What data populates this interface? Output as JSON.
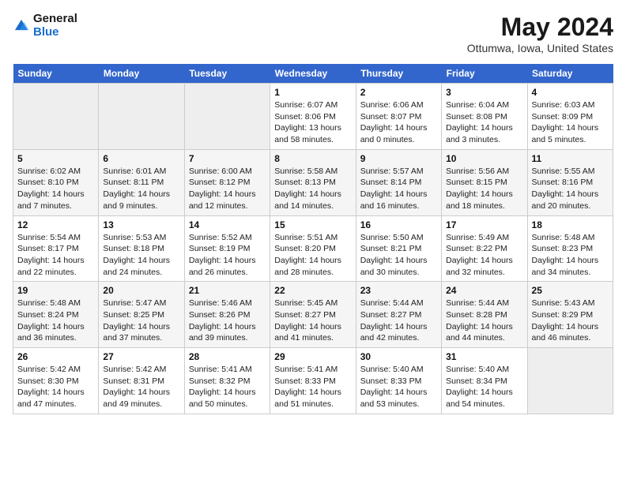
{
  "logo": {
    "general": "General",
    "blue": "Blue"
  },
  "title": "May 2024",
  "subtitle": "Ottumwa, Iowa, United States",
  "days_of_week": [
    "Sunday",
    "Monday",
    "Tuesday",
    "Wednesday",
    "Thursday",
    "Friday",
    "Saturday"
  ],
  "weeks": [
    [
      {
        "num": "",
        "info": ""
      },
      {
        "num": "",
        "info": ""
      },
      {
        "num": "",
        "info": ""
      },
      {
        "num": "1",
        "info": "Sunrise: 6:07 AM\nSunset: 8:06 PM\nDaylight: 13 hours\nand 58 minutes."
      },
      {
        "num": "2",
        "info": "Sunrise: 6:06 AM\nSunset: 8:07 PM\nDaylight: 14 hours\nand 0 minutes."
      },
      {
        "num": "3",
        "info": "Sunrise: 6:04 AM\nSunset: 8:08 PM\nDaylight: 14 hours\nand 3 minutes."
      },
      {
        "num": "4",
        "info": "Sunrise: 6:03 AM\nSunset: 8:09 PM\nDaylight: 14 hours\nand 5 minutes."
      }
    ],
    [
      {
        "num": "5",
        "info": "Sunrise: 6:02 AM\nSunset: 8:10 PM\nDaylight: 14 hours\nand 7 minutes."
      },
      {
        "num": "6",
        "info": "Sunrise: 6:01 AM\nSunset: 8:11 PM\nDaylight: 14 hours\nand 9 minutes."
      },
      {
        "num": "7",
        "info": "Sunrise: 6:00 AM\nSunset: 8:12 PM\nDaylight: 14 hours\nand 12 minutes."
      },
      {
        "num": "8",
        "info": "Sunrise: 5:58 AM\nSunset: 8:13 PM\nDaylight: 14 hours\nand 14 minutes."
      },
      {
        "num": "9",
        "info": "Sunrise: 5:57 AM\nSunset: 8:14 PM\nDaylight: 14 hours\nand 16 minutes."
      },
      {
        "num": "10",
        "info": "Sunrise: 5:56 AM\nSunset: 8:15 PM\nDaylight: 14 hours\nand 18 minutes."
      },
      {
        "num": "11",
        "info": "Sunrise: 5:55 AM\nSunset: 8:16 PM\nDaylight: 14 hours\nand 20 minutes."
      }
    ],
    [
      {
        "num": "12",
        "info": "Sunrise: 5:54 AM\nSunset: 8:17 PM\nDaylight: 14 hours\nand 22 minutes."
      },
      {
        "num": "13",
        "info": "Sunrise: 5:53 AM\nSunset: 8:18 PM\nDaylight: 14 hours\nand 24 minutes."
      },
      {
        "num": "14",
        "info": "Sunrise: 5:52 AM\nSunset: 8:19 PM\nDaylight: 14 hours\nand 26 minutes."
      },
      {
        "num": "15",
        "info": "Sunrise: 5:51 AM\nSunset: 8:20 PM\nDaylight: 14 hours\nand 28 minutes."
      },
      {
        "num": "16",
        "info": "Sunrise: 5:50 AM\nSunset: 8:21 PM\nDaylight: 14 hours\nand 30 minutes."
      },
      {
        "num": "17",
        "info": "Sunrise: 5:49 AM\nSunset: 8:22 PM\nDaylight: 14 hours\nand 32 minutes."
      },
      {
        "num": "18",
        "info": "Sunrise: 5:48 AM\nSunset: 8:23 PM\nDaylight: 14 hours\nand 34 minutes."
      }
    ],
    [
      {
        "num": "19",
        "info": "Sunrise: 5:48 AM\nSunset: 8:24 PM\nDaylight: 14 hours\nand 36 minutes."
      },
      {
        "num": "20",
        "info": "Sunrise: 5:47 AM\nSunset: 8:25 PM\nDaylight: 14 hours\nand 37 minutes."
      },
      {
        "num": "21",
        "info": "Sunrise: 5:46 AM\nSunset: 8:26 PM\nDaylight: 14 hours\nand 39 minutes."
      },
      {
        "num": "22",
        "info": "Sunrise: 5:45 AM\nSunset: 8:27 PM\nDaylight: 14 hours\nand 41 minutes."
      },
      {
        "num": "23",
        "info": "Sunrise: 5:44 AM\nSunset: 8:27 PM\nDaylight: 14 hours\nand 42 minutes."
      },
      {
        "num": "24",
        "info": "Sunrise: 5:44 AM\nSunset: 8:28 PM\nDaylight: 14 hours\nand 44 minutes."
      },
      {
        "num": "25",
        "info": "Sunrise: 5:43 AM\nSunset: 8:29 PM\nDaylight: 14 hours\nand 46 minutes."
      }
    ],
    [
      {
        "num": "26",
        "info": "Sunrise: 5:42 AM\nSunset: 8:30 PM\nDaylight: 14 hours\nand 47 minutes."
      },
      {
        "num": "27",
        "info": "Sunrise: 5:42 AM\nSunset: 8:31 PM\nDaylight: 14 hours\nand 49 minutes."
      },
      {
        "num": "28",
        "info": "Sunrise: 5:41 AM\nSunset: 8:32 PM\nDaylight: 14 hours\nand 50 minutes."
      },
      {
        "num": "29",
        "info": "Sunrise: 5:41 AM\nSunset: 8:33 PM\nDaylight: 14 hours\nand 51 minutes."
      },
      {
        "num": "30",
        "info": "Sunrise: 5:40 AM\nSunset: 8:33 PM\nDaylight: 14 hours\nand 53 minutes."
      },
      {
        "num": "31",
        "info": "Sunrise: 5:40 AM\nSunset: 8:34 PM\nDaylight: 14 hours\nand 54 minutes."
      },
      {
        "num": "",
        "info": ""
      }
    ]
  ]
}
